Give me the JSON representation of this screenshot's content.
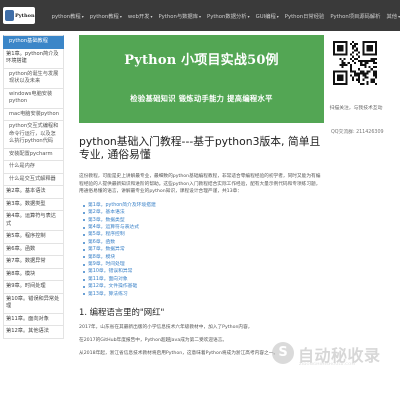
{
  "nav": {
    "logo_text": "Python",
    "items": [
      {
        "label": "python教程",
        "dropdown": true
      },
      {
        "label": "python教程",
        "dropdown": true
      },
      {
        "label": "web开发",
        "dropdown": true
      },
      {
        "label": "Python与数据库",
        "dropdown": true
      },
      {
        "label": "Python数据分析",
        "dropdown": true
      },
      {
        "label": "GUI编程",
        "dropdown": true
      },
      {
        "label": "Python日常经验",
        "dropdown": false
      },
      {
        "label": "Python项目源码解析",
        "dropdown": false
      },
      {
        "label": "其他",
        "dropdown": true
      }
    ],
    "caret": "▾"
  },
  "sidebar": {
    "items": [
      {
        "label": "python基础教程",
        "active": true,
        "cat": false
      },
      {
        "label": "第1章。python简介及环境搭建",
        "active": false,
        "cat": true
      },
      {
        "label": "python的诞生与发展现状以及未来",
        "active": false,
        "cat": false
      },
      {
        "label": "windows电脑安装python",
        "active": false,
        "cat": false
      },
      {
        "label": "mac电脑安装python",
        "active": false,
        "cat": false
      },
      {
        "label": "python交互式编程和命令行运行，以及怎么执行python代码",
        "active": false,
        "cat": false
      },
      {
        "label": "安装配置pycharm",
        "active": false,
        "cat": false
      },
      {
        "label": "什么是内存",
        "active": false,
        "cat": false
      },
      {
        "label": "什么是交互式解释器",
        "active": false,
        "cat": false
      },
      {
        "label": "第2章。基本语法",
        "active": false,
        "cat": true
      },
      {
        "label": "第3章。数据类型",
        "active": false,
        "cat": true
      },
      {
        "label": "第4章。运算符与表达式",
        "active": false,
        "cat": true
      },
      {
        "label": "第5章。程序控制",
        "active": false,
        "cat": true
      },
      {
        "label": "第6章。函数",
        "active": false,
        "cat": true
      },
      {
        "label": "第7章。数据异常",
        "active": false,
        "cat": true
      },
      {
        "label": "第8章。模块",
        "active": false,
        "cat": true
      },
      {
        "label": "第9章。时间处理",
        "active": false,
        "cat": true
      },
      {
        "label": "第10章。错误和异常处理",
        "active": false,
        "cat": true
      },
      {
        "label": "第11章。面向对象",
        "active": false,
        "cat": true
      },
      {
        "label": "第12章。其他语法",
        "active": false,
        "cat": true
      }
    ]
  },
  "banner": {
    "title": "Python 小项目实战50例",
    "subtitle": "检验基础知识   锻炼动手能力   提高编程水平",
    "bg": "#53a654"
  },
  "qr": {
    "caption": "扫描关注，与我技术互动",
    "qq_line": "QQ交流群: 211426309"
  },
  "article": {
    "title": "python基础入门教程---基于python3版本, 简单且专业, 通俗易懂",
    "intro": "这份教程，可能是史上讲解最专业，最细致的python基础编程教程，非常适合零编程经验的初学者，同时又能为有编程经验的人提供最新知识和进阶的帮助。这些python入门教程结合实际工作经验，配有大量示例代码和专项练习题，用通俗易懂的语言，讲解最专业的python知识，课程设计合理严谨，共13章：",
    "toc": [
      "第1章。python简介及环境搭建",
      "第2章。基本语法",
      "第3章。数据类型",
      "第4章。运算符与表达式",
      "第5章。程序控制",
      "第6章。函数",
      "第7章。数据异常",
      "第8章。模块",
      "第9章。时间处理",
      "第10章。错误和异常",
      "第11章。面向对象",
      "第12章。文件操作基础",
      "第13章。算法练习"
    ],
    "section_title": "1. 编程语言里的\"网红\"",
    "paras": [
      "2017年，山东省在其最新出版的小学信息技术六年级教材中，加入了Python内容，",
      "在2017的GitHub年度报告中，Python超越Java成为第二受欢迎语言。",
      "从2018年起，浙江省信息技术教材将启用Python，这意味着Python将成为浙江高考内容之一。"
    ]
  },
  "watermark": {
    "glyph": "S",
    "text": "自动秘收录",
    "sub": "ZIDONGMIMISHOULU.COM"
  }
}
